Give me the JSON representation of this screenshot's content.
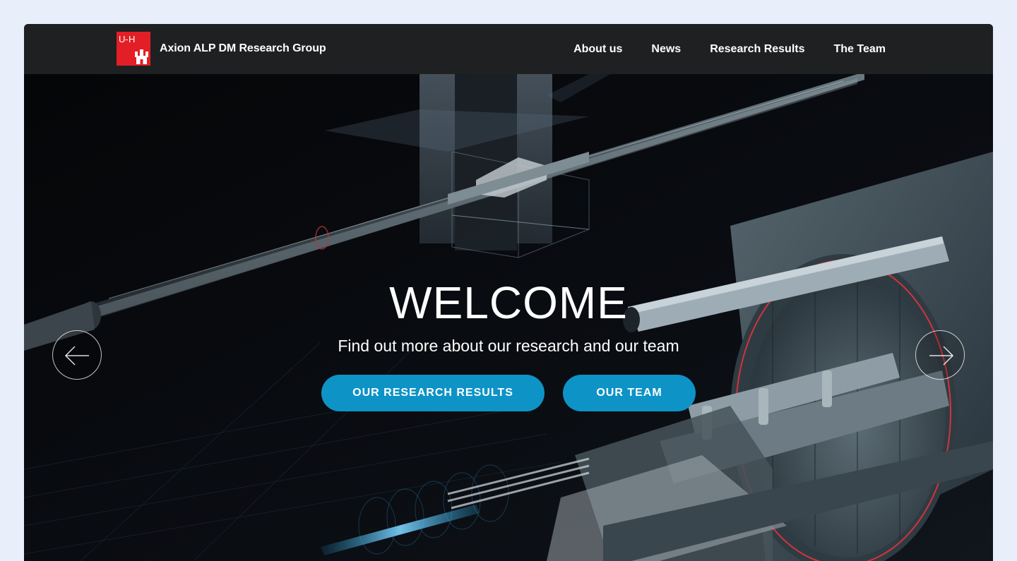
{
  "brand": {
    "logo_text": "UHH",
    "title": "Axion ALP DM Research Group"
  },
  "nav": {
    "items": [
      {
        "label": "About us"
      },
      {
        "label": "News"
      },
      {
        "label": "Research Results"
      },
      {
        "label": "The Team"
      }
    ]
  },
  "hero": {
    "title": "WELCOME",
    "subtitle": "Find out more about our research and our team",
    "primary_button": "OUR RESEARCH RESULTS",
    "secondary_button": "OUR TEAM",
    "prev_icon": "arrow-left-icon",
    "next_icon": "arrow-right-icon"
  },
  "colors": {
    "page_background": "#e8eefa",
    "navbar": "#1f2021",
    "logo_red": "#e41e26",
    "button_blue": "#0e93c6",
    "hero_background": "#07090c"
  }
}
